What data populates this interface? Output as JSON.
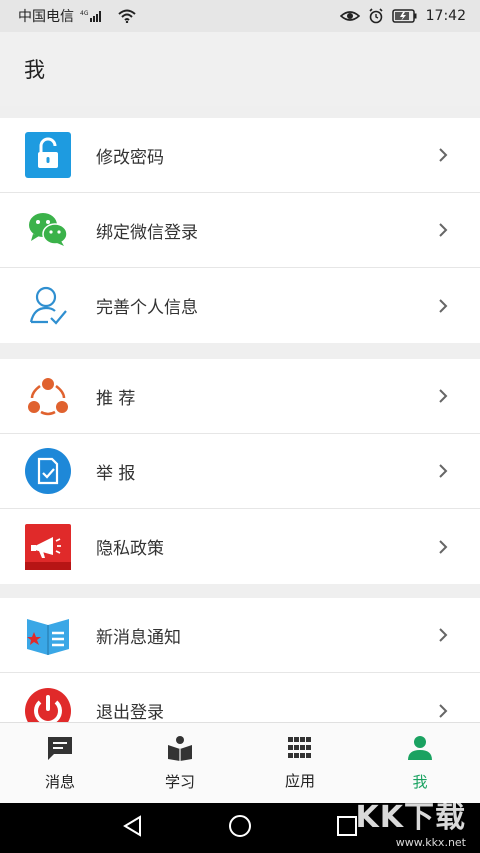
{
  "status_bar": {
    "carrier": "中国电信",
    "network": "4G",
    "time": "17:42"
  },
  "header": {
    "title": "我"
  },
  "groups": [
    {
      "items": [
        {
          "label": "修改密码",
          "icon": "unlock-icon"
        },
        {
          "label": "绑定微信登录",
          "icon": "wechat-icon"
        },
        {
          "label": "完善个人信息",
          "icon": "user-check-icon"
        }
      ]
    },
    {
      "items": [
        {
          "label": "推 荐",
          "icon": "share-network-icon"
        },
        {
          "label": "举 报",
          "icon": "report-document-icon"
        },
        {
          "label": "隐私政策",
          "icon": "megaphone-icon"
        }
      ]
    },
    {
      "items": [
        {
          "label": "新消息通知",
          "icon": "notification-book-icon"
        },
        {
          "label": "退出登录",
          "icon": "power-icon"
        }
      ]
    }
  ],
  "tabbar": {
    "tabs": [
      {
        "label": "消息",
        "icon": "message-icon"
      },
      {
        "label": "学习",
        "icon": "reader-icon"
      },
      {
        "label": "应用",
        "icon": "grid-icon"
      },
      {
        "label": "我",
        "icon": "person-icon",
        "active": true
      }
    ],
    "active_color": "#1aa261"
  },
  "watermark": {
    "text": "KK下载",
    "url": "www.kkx.net"
  }
}
